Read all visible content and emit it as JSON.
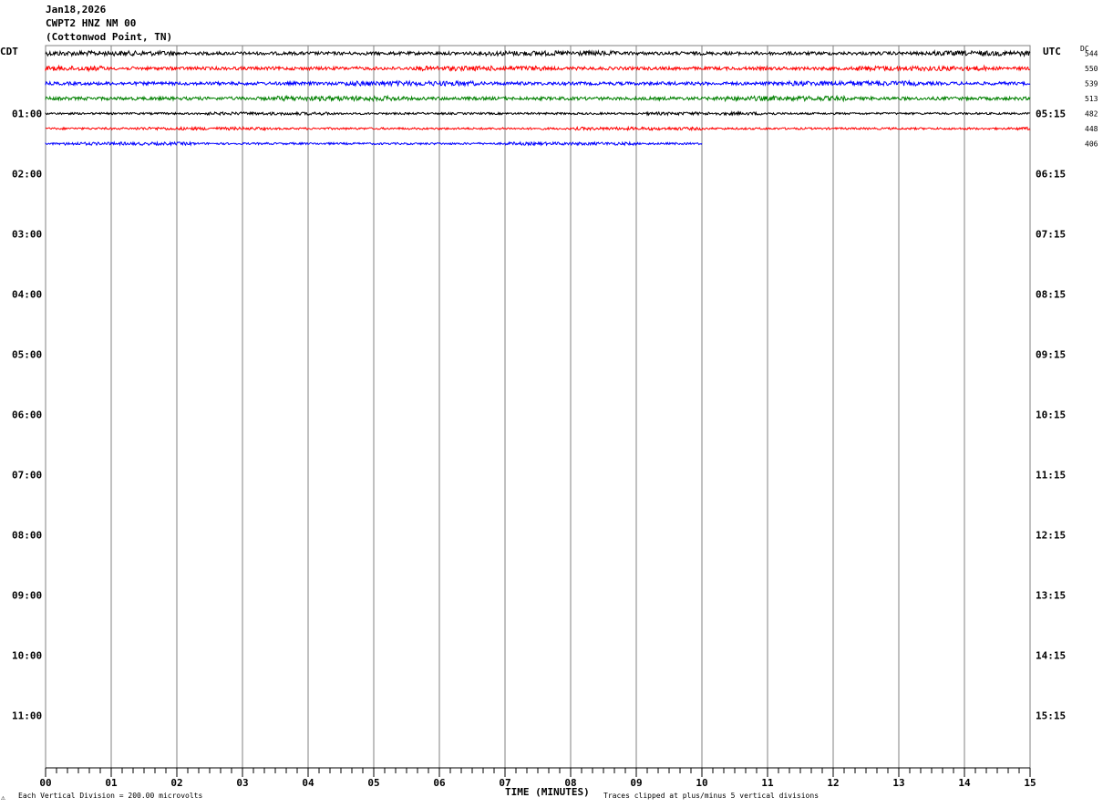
{
  "header": {
    "date": "Jan18,2026",
    "station": "CWPT2 HNZ NM 00",
    "location": "(Cottonwod Point, TN)"
  },
  "left_tz": "CDT",
  "right_tz": "UTC",
  "dc_label": "DC",
  "footer": {
    "logo": "⚠",
    "scale_note": "Each Vertical Division =  200.00 microvolts",
    "axis_title": "TIME (MINUTES)",
    "clip_note": "Traces clipped at plus/minus 5 vertical divisions"
  },
  "chart_data": {
    "type": "line",
    "title": "",
    "xlabel": "TIME (MINUTES)",
    "xlim": [
      0,
      15
    ],
    "x_ticks": [
      "00",
      "01",
      "02",
      "03",
      "04",
      "05",
      "06",
      "07",
      "08",
      "09",
      "10",
      "11",
      "12",
      "13",
      "14",
      "15"
    ],
    "rows_total": 48,
    "left_time_labels": [
      "01:00",
      "02:00",
      "03:00",
      "04:00",
      "05:00",
      "06:00",
      "07:00",
      "08:00",
      "09:00",
      "10:00",
      "11:00"
    ],
    "right_time_labels": [
      "05:15",
      "06:15",
      "07:15",
      "08:15",
      "09:15",
      "10:15",
      "11:15",
      "12:15",
      "13:15",
      "14:15",
      "15:15"
    ],
    "label_row_start": 4,
    "label_row_step": 4,
    "grid": true,
    "colors": [
      "#000000",
      "#ff0000",
      "#0000ff",
      "#008000"
    ],
    "series": [
      {
        "row": 0,
        "color": "#000000",
        "end_minute": 15,
        "dc": "544"
      },
      {
        "row": 1,
        "color": "#ff0000",
        "end_minute": 15,
        "dc": "550"
      },
      {
        "row": 2,
        "color": "#0000ff",
        "end_minute": 15,
        "dc": "539"
      },
      {
        "row": 3,
        "color": "#008000",
        "end_minute": 15,
        "dc": "513"
      },
      {
        "row": 4,
        "color": "#000000",
        "end_minute": 15,
        "dc": "482"
      },
      {
        "row": 5,
        "color": "#ff0000",
        "end_minute": 15,
        "dc": "448"
      },
      {
        "row": 6,
        "color": "#0000ff",
        "end_minute": 10,
        "dc": "406"
      }
    ]
  }
}
